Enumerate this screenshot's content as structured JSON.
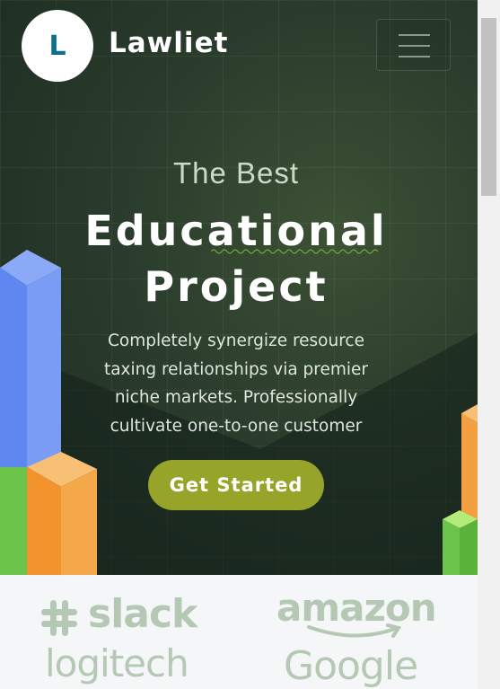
{
  "brand": {
    "logo_letter": "L",
    "name": "Lawliet"
  },
  "nav": {
    "menu_icon": "hamburger-menu-icon"
  },
  "hero": {
    "title_small": "The Best",
    "title_line1": "Educational",
    "title_line2": "Project",
    "description": "Completely synergize resource taxing relationships via premier niche markets. Professionally cultivate one-to-one customer",
    "cta_label": "Get Started"
  },
  "partners": {
    "logos": [
      "slack",
      "amazon",
      "logitech",
      "Google"
    ]
  },
  "colors": {
    "hero_bg": "#2a3c2c",
    "cta": "#97a42a",
    "logo_text": "#0d6e8d",
    "partner_logo": "#b4c8b4"
  }
}
